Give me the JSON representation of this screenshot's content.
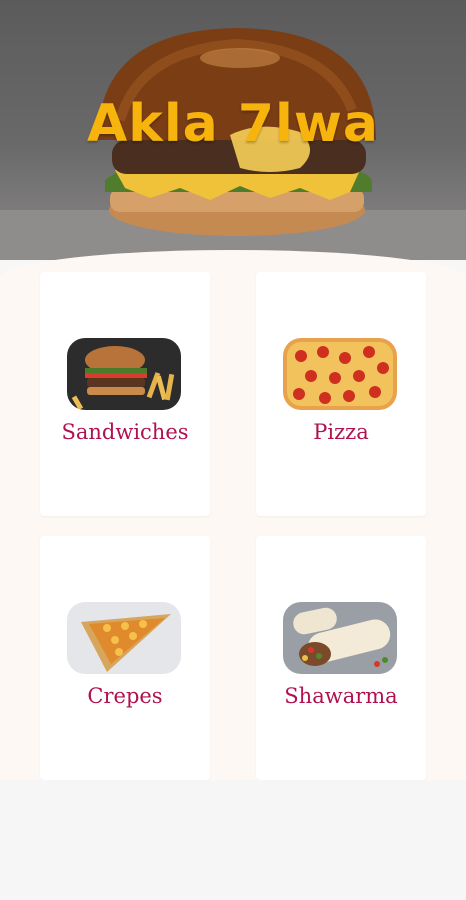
{
  "header": {
    "title": "Akla 7lwa",
    "title_color": "#f6b40c",
    "image": "burger-photo"
  },
  "categories": [
    {
      "label": "Sandwiches",
      "image": "burger-fries-photo"
    },
    {
      "label": "Pizza",
      "image": "pepperoni-pizza-photo"
    },
    {
      "label": "Crepes",
      "image": "crepe-photo"
    },
    {
      "label": "Shawarma",
      "image": "shawarma-wrap-photo"
    }
  ],
  "colors": {
    "label": "#b0124f",
    "content_bg": "#fdf8f4",
    "card_bg": "#ffffff"
  }
}
